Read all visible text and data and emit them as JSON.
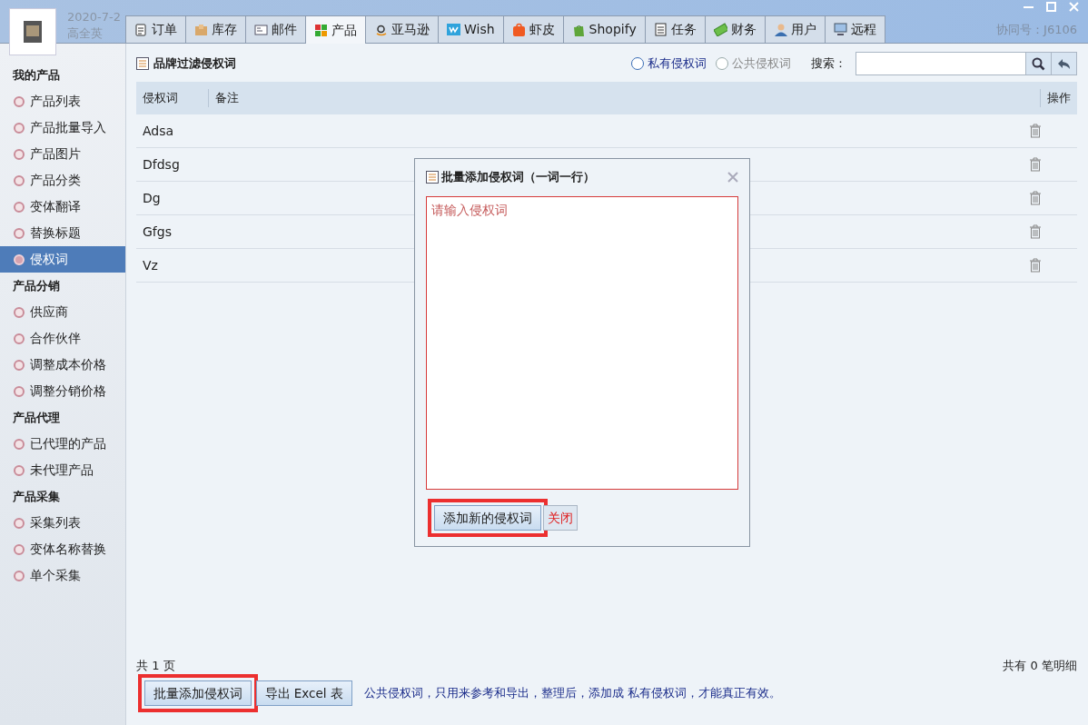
{
  "header": {
    "date": "2020-7-2",
    "user": "高全英",
    "contract_no": "协同号：J6106"
  },
  "tabs": [
    {
      "label": "订单",
      "selected": false
    },
    {
      "label": "库存",
      "selected": false
    },
    {
      "label": "邮件",
      "selected": false
    },
    {
      "label": "产品",
      "selected": true
    },
    {
      "label": "亚马逊",
      "selected": false
    },
    {
      "label": "Wish",
      "selected": false
    },
    {
      "label": "虾皮",
      "selected": false
    },
    {
      "label": "Shopify",
      "selected": false
    },
    {
      "label": "任务",
      "selected": false
    },
    {
      "label": "财务",
      "selected": false
    },
    {
      "label": "用户",
      "selected": false
    },
    {
      "label": "远程",
      "selected": false
    }
  ],
  "sidebar": [
    {
      "title": "我的产品",
      "items": [
        {
          "label": "产品列表",
          "selected": false
        },
        {
          "label": "产品批量导入",
          "selected": false
        },
        {
          "label": "产品图片",
          "selected": false
        },
        {
          "label": "产品分类",
          "selected": false
        },
        {
          "label": "变体翻译",
          "selected": false
        },
        {
          "label": "替换标题",
          "selected": false
        },
        {
          "label": "侵权词",
          "selected": true
        }
      ]
    },
    {
      "title": "产品分销",
      "items": [
        {
          "label": "供应商",
          "selected": false
        },
        {
          "label": "合作伙伴",
          "selected": false
        },
        {
          "label": "调整成本价格",
          "selected": false
        },
        {
          "label": "调整分销价格",
          "selected": false
        }
      ]
    },
    {
      "title": "产品代理",
      "items": [
        {
          "label": "已代理的产品",
          "selected": false
        },
        {
          "label": "未代理产品",
          "selected": false
        }
      ]
    },
    {
      "title": "产品采集",
      "items": [
        {
          "label": "采集列表",
          "selected": false
        },
        {
          "label": "变体名称替换",
          "selected": false
        },
        {
          "label": "单个采集",
          "selected": false
        }
      ]
    }
  ],
  "panel": {
    "title": "品牌过滤侵权词",
    "filters": [
      {
        "label": "私有侵权词",
        "selected": true
      },
      {
        "label": "公共侵权词",
        "selected": false
      }
    ],
    "search_label": "搜索：",
    "columns": [
      "侵权词",
      "备注",
      "操作"
    ],
    "rows": [
      {
        "word": "Adsa"
      },
      {
        "word": "Dfdsg"
      },
      {
        "word": "Dg"
      },
      {
        "word": "Gfgs"
      },
      {
        "word": "Vz"
      }
    ],
    "page_count": "共 1 页",
    "total": "共有 0 笔明细",
    "buttons": [
      {
        "label": "批量添加侵权词",
        "highlighted": true
      },
      {
        "label": "导出 Excel 表",
        "highlighted": false
      }
    ],
    "note": "公共侵权词，只用来参考和导出，整理后，添加成 私有侵权词，才能真正有效。"
  },
  "dialog": {
    "title": "批量添加侵权词（一词一行）",
    "placeholder": "请输入侵权词",
    "buttons": [
      {
        "label": "添加新的侵权词",
        "kind": "button",
        "highlighted": true
      },
      {
        "label": "关闭",
        "kind": "link",
        "highlighted": false
      }
    ]
  }
}
